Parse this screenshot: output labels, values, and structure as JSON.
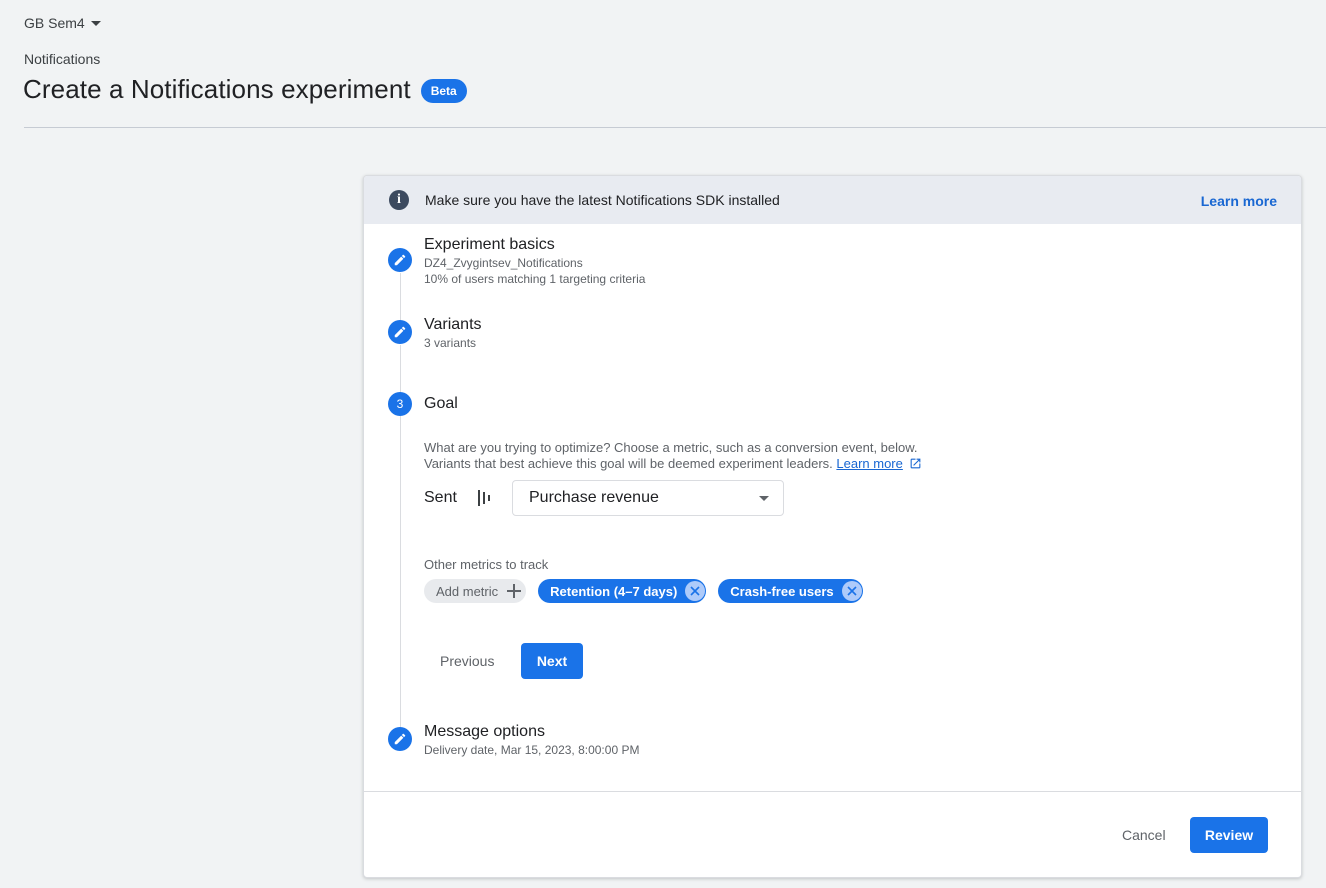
{
  "header": {
    "project": "GB Sem4",
    "breadcrumb": "Notifications",
    "title": "Create a Notifications experiment",
    "badge": "Beta"
  },
  "banner": {
    "text": "Make sure you have the latest Notifications SDK installed",
    "link": "Learn more"
  },
  "steps": [
    {
      "title": "Experiment basics",
      "lines": [
        "DZ4_Zvygintsev_Notifications",
        "10% of users matching 1 targeting criteria"
      ],
      "icon": "edit-icon"
    },
    {
      "title": "Variants",
      "lines": [
        "3 variants"
      ],
      "icon": "edit-icon"
    },
    {
      "number": "3",
      "title": "Goal"
    },
    {
      "title": "Message options",
      "lines": [
        "Delivery date, Mar 15, 2023, 8:00:00 PM"
      ],
      "icon": "edit-icon"
    }
  ],
  "goal": {
    "desc_line1": "What are you trying to optimize? Choose a metric, such as a conversion event, below.",
    "desc_line2": "Variants that best achieve this goal will be deemed experiment leaders.",
    "learn_more": "Learn more",
    "sent_label": "Sent",
    "metric_selected": "Purchase revenue",
    "other_label": "Other metrics to track",
    "add_metric": "Add metric",
    "chips": [
      "Retention (4–7 days)",
      "Crash-free users"
    ],
    "previous": "Previous",
    "next": "Next"
  },
  "footer": {
    "cancel": "Cancel",
    "review": "Review"
  },
  "colors": {
    "primary": "#1a73e8",
    "banner_bg": "#e8ebf1",
    "page_bg": "#f1f3f4"
  }
}
